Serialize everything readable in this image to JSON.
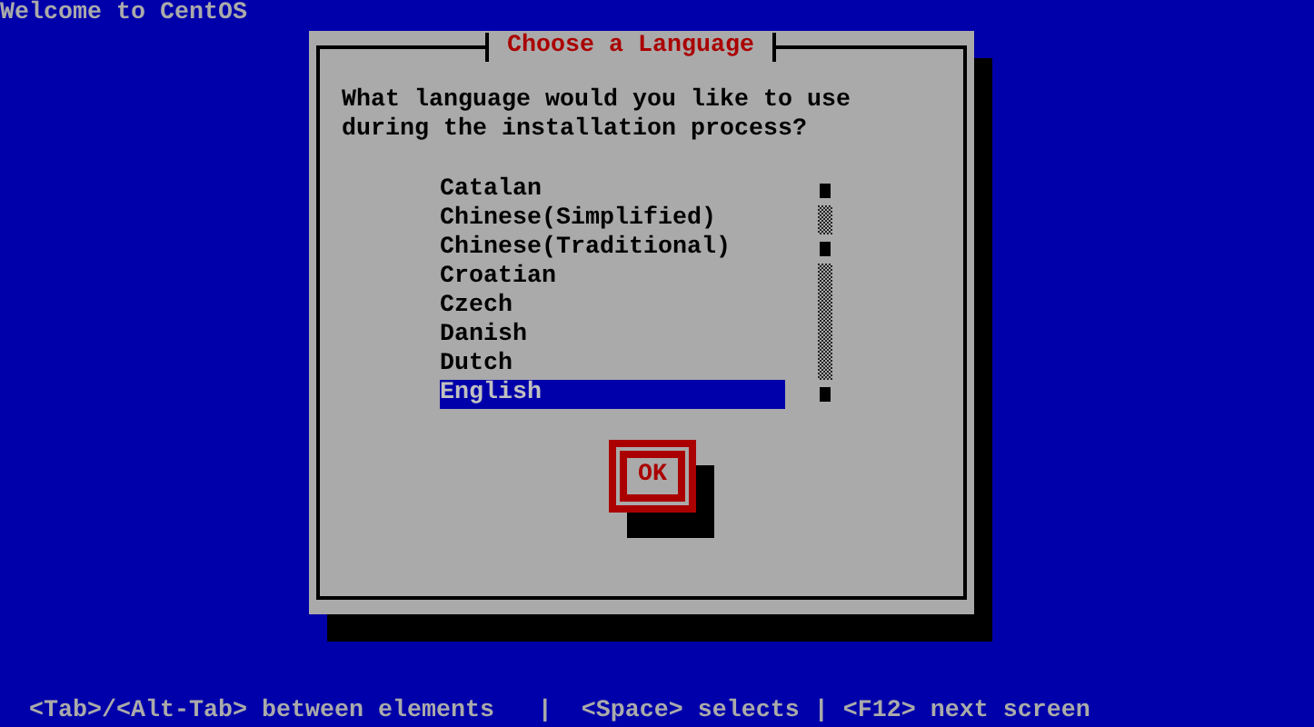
{
  "screen": {
    "title": "Welcome to CentOS"
  },
  "dialog": {
    "title": "Choose a Language",
    "prompt": "What language would you like to use during the installation process?",
    "languages": [
      {
        "label": "Catalan",
        "selected": false
      },
      {
        "label": "Chinese(Simplified)",
        "selected": false
      },
      {
        "label": "Chinese(Traditional)",
        "selected": false
      },
      {
        "label": "Croatian",
        "selected": false
      },
      {
        "label": "Czech",
        "selected": false
      },
      {
        "label": "Danish",
        "selected": false
      },
      {
        "label": "Dutch",
        "selected": false
      },
      {
        "label": "English",
        "selected": true
      }
    ],
    "button": "OK"
  },
  "status_bar": "<Tab>/<Alt-Tab> between elements   |  <Space> selects | <F12> next screen"
}
